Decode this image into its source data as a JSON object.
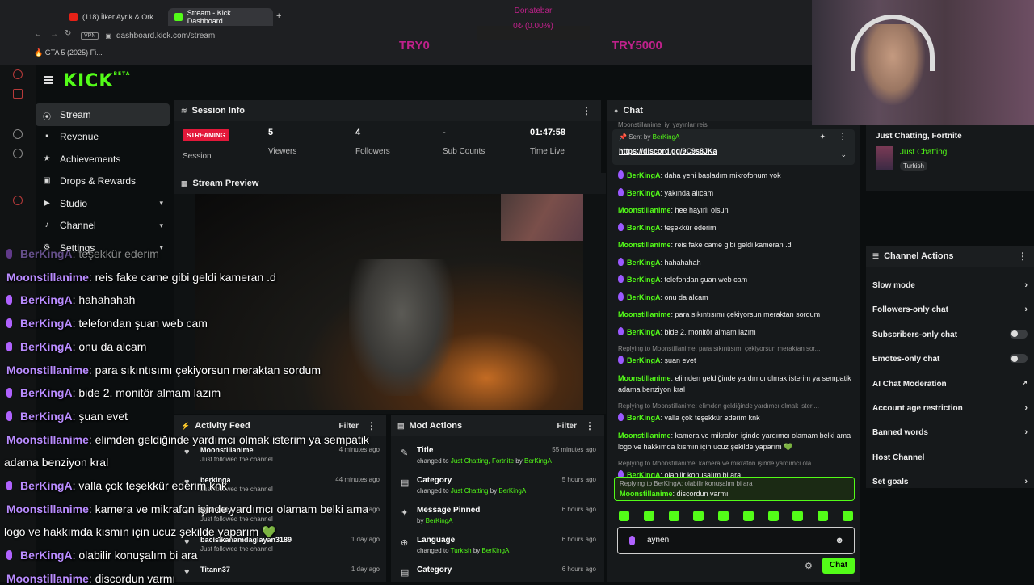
{
  "browser": {
    "tabs": [
      "(118) İlker Ayrık & Ork...",
      "Stream - Kick Dashboard"
    ],
    "url": "dashboard.kick.com/stream",
    "vpn_label": "VPN",
    "bookmark": "🔥 GTA 5 (2025) Fi..."
  },
  "donatebar": {
    "title": "Donatebar",
    "progress_label": "0₺ (0.00%)",
    "min_label": "TRY0",
    "max_label": "TRY5000",
    "progress": 0.0
  },
  "header": {
    "logo": "KICK",
    "logo_beta": "BETA"
  },
  "nav": {
    "items": [
      {
        "label": "Stream",
        "icon": "⦿",
        "chev": ""
      },
      {
        "label": "Revenue",
        "icon": "▪",
        "chev": ""
      },
      {
        "label": "Achievements",
        "icon": "★",
        "chev": ""
      },
      {
        "label": "Drops & Rewards",
        "icon": "▣",
        "chev": ""
      },
      {
        "label": "Studio",
        "icon": "▶",
        "chev": "▾"
      },
      {
        "label": "Channel",
        "icon": "♪",
        "chev": "▾"
      },
      {
        "label": "Settings",
        "icon": "⚙",
        "chev": "▾"
      }
    ]
  },
  "session_info": {
    "title": "Session Info",
    "badge": "STREAMING",
    "session_label": "Session",
    "stats": [
      {
        "value": "5",
        "label": "Viewers"
      },
      {
        "value": "4",
        "label": "Followers"
      },
      {
        "value": "-",
        "label": "Sub Counts"
      },
      {
        "value": "01:47:58",
        "label": "Time Live"
      }
    ]
  },
  "stream_preview": {
    "title": "Stream Preview"
  },
  "activity_feed": {
    "title": "Activity Feed",
    "filter": "Filter",
    "rows": [
      {
        "name": "Moonstillanime",
        "sub": "Just followed the channel",
        "time": "4 minutes ago"
      },
      {
        "name": "berkinga",
        "sub": "Just followed the channel",
        "time": "44 minutes ago"
      },
      {
        "name": "cyanobly",
        "sub": "Just followed the channel",
        "time": "1 hour ago"
      },
      {
        "name": "bacisikanamdaglayan3189",
        "sub": "Just followed the channel",
        "time": "1 day ago"
      },
      {
        "name": "Titann37",
        "sub": "",
        "time": "1 day ago"
      }
    ]
  },
  "mod_actions": {
    "title": "Mod Actions",
    "filter": "Filter",
    "rows": [
      {
        "icon": "✎",
        "name": "Title",
        "pre": "changed to ",
        "hl": "Just Chatting, Fortnite",
        "mid": " by ",
        "by": "BerKingA",
        "time": "55 minutes ago"
      },
      {
        "icon": "▤",
        "name": "Category",
        "pre": "changed to ",
        "hl": "Just Chatting",
        "mid": " by ",
        "by": "BerKingA",
        "time": "5 hours ago"
      },
      {
        "icon": "✦",
        "name": "Message Pinned",
        "pre": "by ",
        "hl": "",
        "mid": "",
        "by": "BerKingA",
        "time": "6 hours ago"
      },
      {
        "icon": "⊕",
        "name": "Language",
        "pre": "changed to ",
        "hl": "Turkish",
        "mid": " by ",
        "by": "BerKingA",
        "time": "6 hours ago"
      },
      {
        "icon": "▤",
        "name": "Category",
        "pre": "",
        "hl": "",
        "mid": "",
        "by": "",
        "time": "6 hours ago"
      }
    ]
  },
  "chat": {
    "title": "Chat",
    "top_partial": "Moonstillanime: iyi yayınlar reis",
    "pinned_by_label": "Sent by",
    "pinned_by": "BerKingA",
    "pinned_link": "https://discord.gg/9C9s8JKa",
    "messages": [
      {
        "user": "BerKingA",
        "badge": true,
        "text": "daha yeni başladım mikrofonum yok",
        "reply": ""
      },
      {
        "user": "BerKingA",
        "badge": true,
        "text": "yakında alıcam",
        "reply": ""
      },
      {
        "user": "Moonstillanime",
        "badge": false,
        "text": "hee hayırlı olsun",
        "reply": ""
      },
      {
        "user": "BerKingA",
        "badge": true,
        "text": "teşekkür ederim",
        "reply": ""
      },
      {
        "user": "Moonstillanime",
        "badge": false,
        "text": "reis fake came gibi geldi kameran .d",
        "reply": ""
      },
      {
        "user": "BerKingA",
        "badge": true,
        "text": "hahahahah",
        "reply": ""
      },
      {
        "user": "BerKingA",
        "badge": true,
        "text": "telefondan şuan web cam",
        "reply": ""
      },
      {
        "user": "BerKingA",
        "badge": true,
        "text": "onu da alcam",
        "reply": ""
      },
      {
        "user": "Moonstillanime",
        "badge": false,
        "text": "para sıkıntısımı çekiyorsun meraktan sordum",
        "reply": ""
      },
      {
        "user": "BerKingA",
        "badge": true,
        "text": "bide 2. monitör almam lazım",
        "reply": ""
      },
      {
        "user": "BerKingA",
        "badge": true,
        "text": "şuan evet",
        "reply": "Replying to Moonstillanime: para sıkıntısımı çekiyorsun meraktan sor..."
      },
      {
        "user": "Moonstillanime",
        "badge": false,
        "text": "elimden geldiğinde yardımcı olmak isterim ya sempatik adama benziyon kral",
        "reply": ""
      },
      {
        "user": "BerKingA",
        "badge": true,
        "text": "valla çok teşekkür ederim knk",
        "reply": "Replying to Moonstillanime: elimden geldiğinde yardımcı olmak isteri..."
      },
      {
        "user": "Moonstillanime",
        "badge": false,
        "text": "kamera ve mikrafon işinde yardımcı olamam belki ama logo ve hakkımda kısmın için ucuz şekilde yaparım 💚",
        "reply": ""
      },
      {
        "user": "BerKingA",
        "badge": true,
        "text": "olabilir konuşalım bi ara",
        "reply": "Replying to Moonstillanime: kamera ve mikrafon işinde yardımcı ola..."
      }
    ],
    "highlight": {
      "reply": "Replying to BerKingA: olabilir konuşalım bi ara",
      "user": "Moonstillanime",
      "text": "discordun varmı"
    },
    "input_value": "aynen",
    "send_label": "Chat",
    "accent": "#53fc18"
  },
  "stream_info": {
    "title": "Just Chatting, Fortnite",
    "category": "Just Chatting",
    "tag": "Turkish"
  },
  "channel_actions": {
    "title": "Channel Actions",
    "rows": [
      {
        "label": "Slow mode",
        "ctrl": "arrow"
      },
      {
        "label": "Followers-only chat",
        "ctrl": "arrow"
      },
      {
        "label": "Subscribers-only chat",
        "ctrl": "toggle"
      },
      {
        "label": "Emotes-only chat",
        "ctrl": "toggle"
      },
      {
        "label": "AI Chat Moderation",
        "ctrl": "ext"
      },
      {
        "label": "Account age restriction",
        "ctrl": "arrow"
      },
      {
        "label": "Banned words",
        "ctrl": "arrow"
      },
      {
        "label": "Host Channel",
        "ctrl": ""
      },
      {
        "label": "Set goals",
        "ctrl": "arrow"
      }
    ]
  },
  "overlay_chat": [
    {
      "user": "BerKingA",
      "mic": true,
      "text": ": teşekkür ederim"
    },
    {
      "user": "Moonstillanime",
      "mic": false,
      "text": ": reis fake came gibi geldi kameran .d"
    },
    {
      "user": "BerKingA",
      "mic": true,
      "text": ": hahahahah"
    },
    {
      "user": "BerKingA",
      "mic": true,
      "text": ": telefondan şuan web cam"
    },
    {
      "user": "BerKingA",
      "mic": true,
      "text": ": onu da alcam"
    },
    {
      "user": "Moonstillanime",
      "mic": false,
      "text": ": para sıkıntısımı çekiyorsun meraktan sordum"
    },
    {
      "user": "BerKingA",
      "mic": true,
      "text": ": bide 2. monitör almam lazım"
    },
    {
      "user": "BerKingA",
      "mic": true,
      "text": ": şuan evet"
    },
    {
      "user": "Moonstillanime",
      "mic": false,
      "text": ": elimden geldiğinde yardımcı olmak isterim ya sempatik"
    },
    {
      "user": "",
      "mic": false,
      "text": "adama benziyon kral"
    },
    {
      "user": "BerKingA",
      "mic": true,
      "text": ": valla çok teşekkür ederim knk"
    },
    {
      "user": "Moonstillanime",
      "mic": false,
      "text": ": kamera ve mikrafon işinde yardımcı olamam belki ama"
    },
    {
      "user": "",
      "mic": false,
      "text": "logo ve hakkımda kısmın için ucuz şekilde yaparım 💚"
    },
    {
      "user": "BerKingA",
      "mic": true,
      "text": ": olabilir konuşalım bi ara"
    },
    {
      "user": "Moonstillanime",
      "mic": false,
      "text": ": discordun varmı"
    }
  ]
}
